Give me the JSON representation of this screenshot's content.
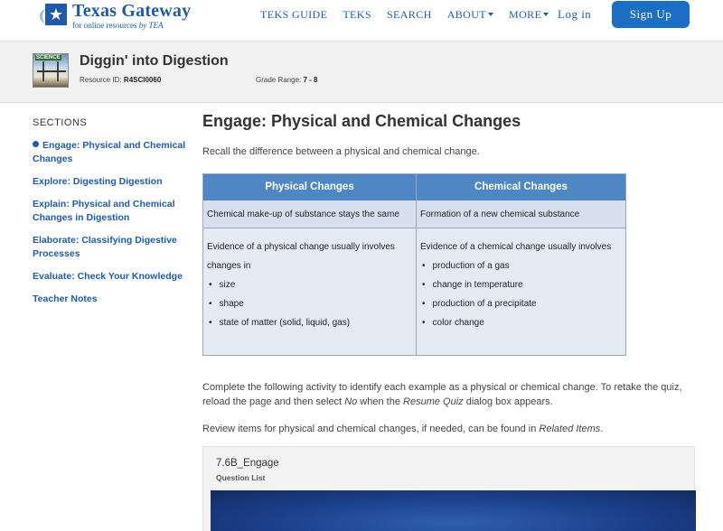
{
  "nav": {
    "logo_title": "Texas Gateway",
    "logo_subtitle": "for online resources",
    "logo_by": "by TEA",
    "links": [
      "TEKS GUIDE",
      "TEKS",
      "SEARCH",
      "ABOUT",
      "MORE"
    ],
    "login": "Log in",
    "signup": "Sign Up"
  },
  "resource": {
    "thumb_label": "SCIENCE",
    "title": "Diggin' into Digestion",
    "id_label": "Resource ID:",
    "id_value": "R4SCI0060",
    "grade_label": "Grade Range:",
    "grade_value": "7 - 8"
  },
  "sidebar": {
    "heading": "SECTIONS",
    "items": [
      "Engage: Physical and Chemical Changes",
      "Explore: Digesting Digestion",
      "Explain: Physical and Chemical Changes in Digestion",
      "Elaborate: Classifying Digestive Processes",
      "Evaluate: Check Your Knowledge",
      "Teacher Notes"
    ]
  },
  "main": {
    "title": "Engage: Physical and Chemical Changes",
    "intro": "Recall the difference between a physical and chemical change.",
    "table": {
      "headers": [
        "Physical Changes",
        "Chemical Changes"
      ],
      "row1": [
        "Chemical make-up of substance stays the same",
        "Formation of a new chemical substance"
      ],
      "physical_evidence_intro": "Evidence of a physical change usually involves changes in",
      "physical_items": [
        "size",
        "shape",
        "state of matter (solid, liquid, gas)"
      ],
      "chemical_evidence_intro": "Evidence of a chemical change usually involves",
      "chemical_items": [
        "production of a gas",
        "change in temperature",
        "production of a precipitate",
        "color change"
      ]
    },
    "para1_a": "Complete the following activity to identify each example as a physical or chemical change. To retake the quiz, reload the page and then select ",
    "para1_no": "No",
    "para1_b": " when the ",
    "para1_resume": "Resume Quiz",
    "para1_c": " dialog box appears.",
    "para2_a": "Review items for physical and chemical changes, if needed, can be found in ",
    "para2_related": "Related Items",
    "para2_b": ".",
    "quiz_title": "7.6B_Engage",
    "quiz_subtitle": "Question List"
  }
}
